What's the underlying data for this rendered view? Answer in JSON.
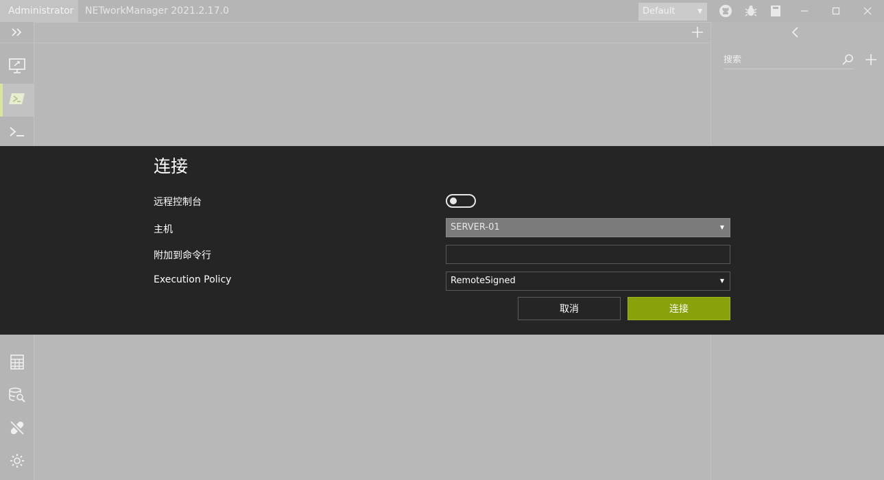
{
  "titlebar": {
    "user_badge": "Administrator",
    "app_title": "NETworkManager 2021.2.17.0",
    "profile_file": "Default",
    "icons": [
      "github-icon",
      "bug-icon",
      "book-icon"
    ],
    "window_controls": [
      "minimize-icon",
      "maximize-icon",
      "close-icon"
    ]
  },
  "leftnav": {
    "top_items": [
      "remote-desktop-icon",
      "powershell-icon",
      "terminal-icon"
    ],
    "active_item": "powershell-icon",
    "bottom_items": [
      "calculator-icon",
      "database-search-icon",
      "disconnected-icon",
      "settings-icon"
    ]
  },
  "profiles_panel": {
    "search_placeholder": "搜索"
  },
  "dialog": {
    "title": "连接",
    "remote_console_label": "远程控制台",
    "remote_console_on": false,
    "host_label": "主机",
    "host_value": "SERVER-01",
    "additional_cmd_label": "附加到命令行",
    "additional_cmd_value": "",
    "execution_policy_label": "Execution Policy",
    "execution_policy_value": "RemoteSigned",
    "cancel_label": "取消",
    "connect_label": "连接",
    "accent_color": "#89a20a"
  }
}
